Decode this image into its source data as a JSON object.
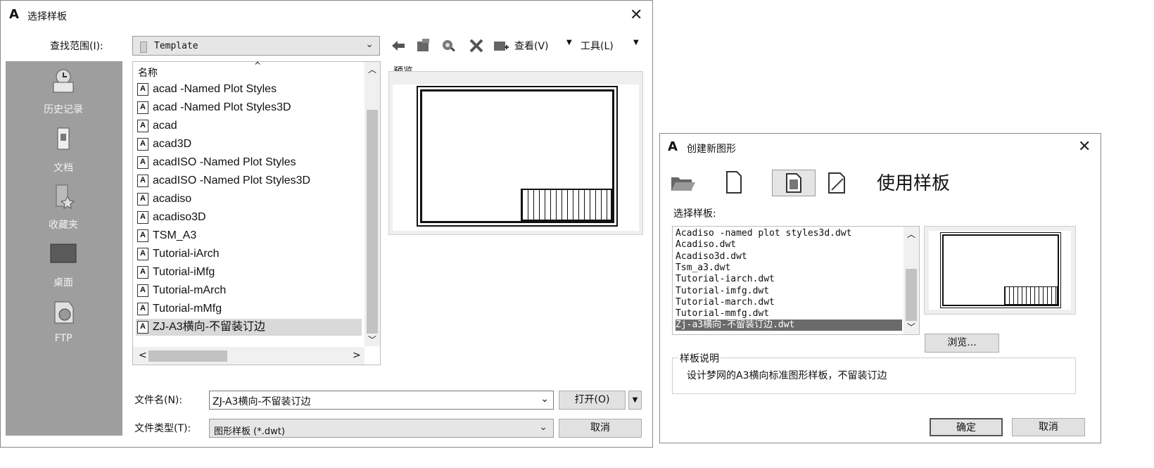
{
  "left_dialog": {
    "title": "选择样板",
    "lookin_label": "查找范围(I):",
    "lookin_value": "Template",
    "view_menu": "查看(V)",
    "tools_menu": "工具(L)",
    "places": [
      {
        "label": "历史记录",
        "icon": "history-icon"
      },
      {
        "label": "文档",
        "icon": "documents-icon"
      },
      {
        "label": "收藏夹",
        "icon": "favorites-icon"
      },
      {
        "label": "桌面",
        "icon": "desktop-icon"
      },
      {
        "label": "FTP",
        "icon": "ftp-icon"
      }
    ],
    "list_header": "名称",
    "files": [
      "acad -Named Plot Styles",
      "acad -Named Plot Styles3D",
      "acad",
      "acad3D",
      "acadISO -Named Plot Styles",
      "acadISO -Named Plot Styles3D",
      "acadiso",
      "acadiso3D",
      "TSM_A3",
      "Tutorial-iArch",
      "Tutorial-iMfg",
      "Tutorial-mArch",
      "Tutorial-mMfg",
      "ZJ-A3横向-不留装订边"
    ],
    "selected_index": 13,
    "preview_label": "预览",
    "filename_label": "文件名(N):",
    "filename_value": "ZJ-A3横向-不留装订边",
    "filetype_label": "文件类型(T):",
    "filetype_value": "图形样板 (*.dwt)",
    "open_button": "打开(O)",
    "cancel_button": "取消"
  },
  "right_dialog": {
    "title": "创建新图形",
    "heading": "使用样板",
    "select_label": "选择样板:",
    "templates": [
      "Acadiso -named plot styles3d.dwt",
      "Acadiso.dwt",
      "Acadiso3d.dwt",
      "Tsm_a3.dwt",
      "Tutorial-iarch.dwt",
      "Tutorial-imfg.dwt",
      "Tutorial-march.dwt",
      "Tutorial-mmfg.dwt",
      "Zj-a3横向-不留装订边.dwt"
    ],
    "selected_index": 8,
    "browse_button": "浏览...",
    "desc_label": "样板说明",
    "desc_text": "设计梦网的A3横向标准图形样板，不留装订边",
    "ok_button": "确定",
    "cancel_button": "取消"
  }
}
